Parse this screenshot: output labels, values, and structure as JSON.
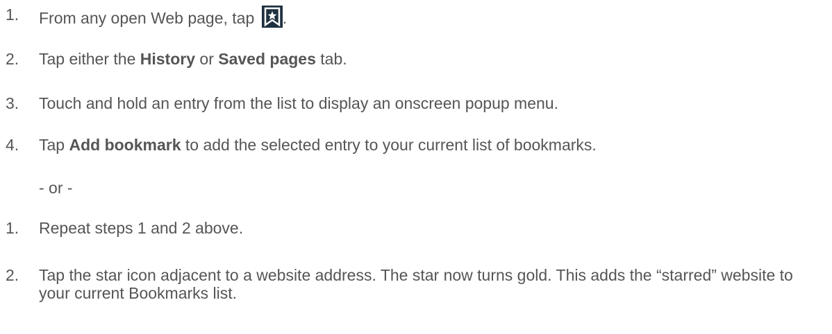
{
  "list_a": [
    {
      "number": "1.",
      "text_before": "From any open Web page, tap",
      "text_after": "."
    },
    {
      "number": "2.",
      "t1": "Tap either the ",
      "b1": "History",
      "t2": " or ",
      "b2": "Saved pages",
      "t3": " tab."
    },
    {
      "number": "3.",
      "text": "Touch and hold an entry from the list to display an onscreen popup menu."
    },
    {
      "number": "4.",
      "t1": "Tap ",
      "b1": "Add bookmark",
      "t2": " to add the selected entry to your current list of bookmarks."
    }
  ],
  "or_text": "- or -",
  "list_b": [
    {
      "number": "1.",
      "text": "Repeat steps 1 and 2 above."
    },
    {
      "number": "2.",
      "text": "Tap the star icon adjacent to a website address. The star now turns gold. This adds the “starred” website to your current Bookmarks list."
    }
  ],
  "colors": {
    "text": "#555555",
    "icon_bg": "#1f3140",
    "icon_fg": "#ffffff"
  },
  "icons": {
    "bookmark": "bookmark-star-icon"
  }
}
